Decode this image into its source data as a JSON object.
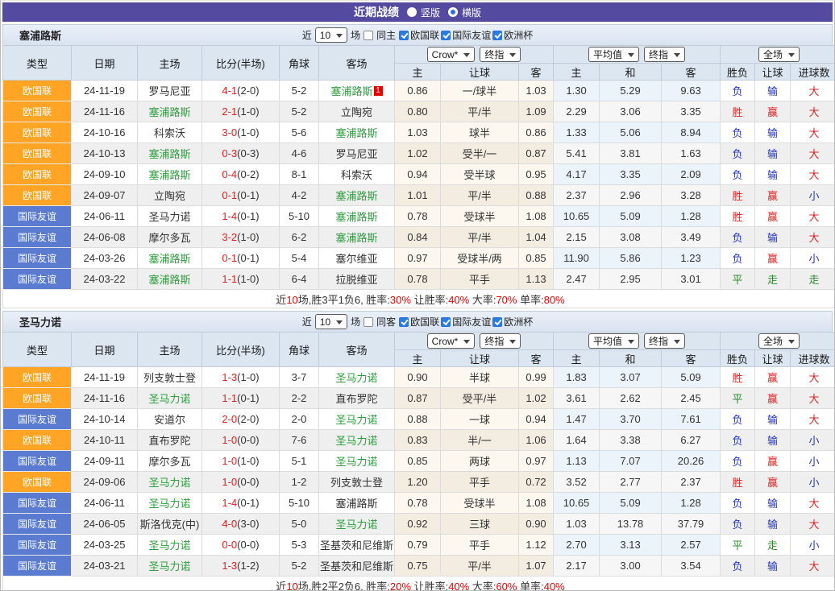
{
  "title_bar": {
    "title": "近期战绩",
    "radios": [
      {
        "label": "竖版",
        "checked": false
      },
      {
        "label": "横版",
        "checked": true
      }
    ]
  },
  "colors": {
    "titlebar_purple": "#544a9f",
    "focus_team_green": "#2e9e3e",
    "win_red": "#e02222",
    "lose_blue": "#2233cc",
    "draw_green": "#2e8b2e",
    "league_colors": {
      "欧国联": "#ffa424",
      "国际友谊": "#5a7bd0"
    }
  },
  "columns": [
    "类型",
    "日期",
    "主场",
    "比分(半场)",
    "角球",
    "客场",
    "主",
    "让球",
    "客",
    "主",
    "和",
    "客",
    "胜负",
    "让球",
    "进球数"
  ],
  "dropdowns": {
    "odds_source": "Crow*",
    "odds_final": "终指",
    "avg_source": "平均值",
    "avg_final": "终指",
    "scope": "全场"
  },
  "sections": [
    {
      "team": "塞浦路斯",
      "filter": {
        "near_label": "近",
        "count": "10",
        "games_label": "场",
        "same_label": "同主",
        "same_checked": false,
        "comps": [
          {
            "label": "欧国联",
            "checked": true
          },
          {
            "label": "国际友谊",
            "checked": true
          },
          {
            "label": "欧洲杯",
            "checked": true
          }
        ]
      },
      "rows": [
        {
          "type": "欧国联",
          "date": "24-11-19",
          "home": "罗马尼亚",
          "score": "4-1",
          "half": "(2-0)",
          "corners": "5-2",
          "away": "塞浦路斯",
          "away_badge": "1",
          "focus": "away",
          "odds": [
            "0.86",
            "一/球半",
            "1.03"
          ],
          "avg": [
            "1.30",
            "5.29",
            "9.63"
          ],
          "results": [
            [
              "负",
              "blue"
            ],
            [
              "输",
              "blue"
            ],
            [
              "大",
              "red"
            ]
          ]
        },
        {
          "type": "欧国联",
          "date": "24-11-16",
          "home": "塞浦路斯",
          "score": "2-1",
          "half": "(1-0)",
          "corners": "5-2",
          "away": "立陶宛",
          "focus": "home",
          "odds": [
            "0.80",
            "平/半",
            "1.09"
          ],
          "avg": [
            "2.29",
            "3.06",
            "3.35"
          ],
          "results": [
            [
              "胜",
              "red"
            ],
            [
              "赢",
              "red"
            ],
            [
              "大",
              "red"
            ]
          ]
        },
        {
          "type": "欧国联",
          "date": "24-10-16",
          "home": "科索沃",
          "score": "3-0",
          "half": "(1-0)",
          "corners": "5-6",
          "away": "塞浦路斯",
          "focus": "away",
          "odds": [
            "1.03",
            "球半",
            "0.86"
          ],
          "avg": [
            "1.33",
            "5.06",
            "8.94"
          ],
          "results": [
            [
              "负",
              "blue"
            ],
            [
              "输",
              "blue"
            ],
            [
              "大",
              "red"
            ]
          ]
        },
        {
          "type": "欧国联",
          "date": "24-10-13",
          "home": "塞浦路斯",
          "score": "0-3",
          "half": "(0-3)",
          "corners": "4-6",
          "away": "罗马尼亚",
          "focus": "home",
          "odds": [
            "1.02",
            "受半/一",
            "0.87"
          ],
          "avg": [
            "5.41",
            "3.81",
            "1.63"
          ],
          "results": [
            [
              "负",
              "blue"
            ],
            [
              "输",
              "blue"
            ],
            [
              "大",
              "red"
            ]
          ]
        },
        {
          "type": "欧国联",
          "date": "24-09-10",
          "home": "塞浦路斯",
          "score": "0-4",
          "half": "(0-2)",
          "corners": "8-1",
          "away": "科索沃",
          "focus": "home",
          "odds": [
            "0.94",
            "受半球",
            "0.95"
          ],
          "avg": [
            "4.17",
            "3.35",
            "2.09"
          ],
          "results": [
            [
              "负",
              "blue"
            ],
            [
              "输",
              "blue"
            ],
            [
              "大",
              "red"
            ]
          ]
        },
        {
          "type": "欧国联",
          "date": "24-09-07",
          "home": "立陶宛",
          "score": "0-1",
          "half": "(0-1)",
          "corners": "4-2",
          "away": "塞浦路斯",
          "focus": "away",
          "odds": [
            "1.01",
            "平/半",
            "0.88"
          ],
          "avg": [
            "2.37",
            "2.96",
            "3.28"
          ],
          "results": [
            [
              "胜",
              "red"
            ],
            [
              "赢",
              "red"
            ],
            [
              "小",
              "blue"
            ]
          ]
        },
        {
          "type": "国际友谊",
          "date": "24-06-11",
          "home": "圣马力诺",
          "score": "1-4",
          "half": "(0-1)",
          "corners": "5-10",
          "away": "塞浦路斯",
          "focus": "away",
          "odds": [
            "0.78",
            "受球半",
            "1.08"
          ],
          "avg": [
            "10.65",
            "5.09",
            "1.28"
          ],
          "results": [
            [
              "胜",
              "red"
            ],
            [
              "赢",
              "red"
            ],
            [
              "大",
              "red"
            ]
          ]
        },
        {
          "type": "国际友谊",
          "date": "24-06-08",
          "home": "摩尔多瓦",
          "score": "3-2",
          "half": "(1-0)",
          "corners": "6-2",
          "away": "塞浦路斯",
          "focus": "away",
          "odds": [
            "0.84",
            "平/半",
            "1.04"
          ],
          "avg": [
            "2.15",
            "3.08",
            "3.49"
          ],
          "results": [
            [
              "负",
              "blue"
            ],
            [
              "输",
              "blue"
            ],
            [
              "大",
              "red"
            ]
          ]
        },
        {
          "type": "国际友谊",
          "date": "24-03-26",
          "home": "塞浦路斯",
          "score": "0-1",
          "half": "(0-1)",
          "corners": "5-4",
          "away": "塞尔维亚",
          "focus": "home",
          "odds": [
            "0.97",
            "受球半/两",
            "0.85"
          ],
          "avg": [
            "11.90",
            "5.86",
            "1.23"
          ],
          "results": [
            [
              "负",
              "blue"
            ],
            [
              "赢",
              "red"
            ],
            [
              "小",
              "blue"
            ]
          ]
        },
        {
          "type": "国际友谊",
          "date": "24-03-22",
          "home": "塞浦路斯",
          "score": "1-1",
          "half": "(1-0)",
          "corners": "6-4",
          "away": "拉脱维亚",
          "focus": "home",
          "odds": [
            "0.78",
            "平手",
            "1.13"
          ],
          "avg": [
            "2.47",
            "2.95",
            "3.01"
          ],
          "results": [
            [
              "平",
              "green"
            ],
            [
              "走",
              "green"
            ],
            [
              "走",
              "green"
            ]
          ]
        }
      ],
      "summary": [
        [
          "近",
          0
        ],
        [
          "10",
          1
        ],
        [
          "场,胜3平1负6, 胜率:",
          0
        ],
        [
          "30%",
          1
        ],
        [
          " 让胜率:",
          0
        ],
        [
          "40%",
          1
        ],
        [
          " 大率:",
          0
        ],
        [
          "70%",
          1
        ],
        [
          " 单率:",
          0
        ],
        [
          "80%",
          1
        ]
      ]
    },
    {
      "team": "圣马力诺",
      "filter": {
        "near_label": "近",
        "count": "10",
        "games_label": "场",
        "same_label": "同客",
        "same_checked": false,
        "comps": [
          {
            "label": "欧国联",
            "checked": true
          },
          {
            "label": "国际友谊",
            "checked": true
          },
          {
            "label": "欧洲杯",
            "checked": true
          }
        ]
      },
      "rows": [
        {
          "type": "欧国联",
          "date": "24-11-19",
          "home": "列支敦士登",
          "score": "1-3",
          "half": "(1-0)",
          "corners": "3-7",
          "away": "圣马力诺",
          "focus": "away",
          "odds": [
            "0.90",
            "半球",
            "0.99"
          ],
          "avg": [
            "1.83",
            "3.07",
            "5.09"
          ],
          "results": [
            [
              "胜",
              "red"
            ],
            [
              "赢",
              "red"
            ],
            [
              "大",
              "red"
            ]
          ]
        },
        {
          "type": "欧国联",
          "date": "24-11-16",
          "home": "圣马力诺",
          "score": "1-1",
          "half": "(0-1)",
          "corners": "2-2",
          "away": "直布罗陀",
          "focus": "home",
          "odds": [
            "0.87",
            "受平/半",
            "1.02"
          ],
          "avg": [
            "3.61",
            "2.62",
            "2.45"
          ],
          "results": [
            [
              "平",
              "green"
            ],
            [
              "赢",
              "red"
            ],
            [
              "大",
              "red"
            ]
          ]
        },
        {
          "type": "国际友谊",
          "date": "24-10-14",
          "home": "安道尔",
          "score": "2-0",
          "half": "(2-0)",
          "corners": "2-0",
          "away": "圣马力诺",
          "focus": "away",
          "odds": [
            "0.88",
            "一球",
            "0.94"
          ],
          "avg": [
            "1.47",
            "3.70",
            "7.61"
          ],
          "results": [
            [
              "负",
              "blue"
            ],
            [
              "输",
              "blue"
            ],
            [
              "大",
              "red"
            ]
          ]
        },
        {
          "type": "欧国联",
          "date": "24-10-11",
          "home": "直布罗陀",
          "score": "1-0",
          "half": "(0-0)",
          "corners": "7-6",
          "away": "圣马力诺",
          "focus": "away",
          "odds": [
            "0.83",
            "半/一",
            "1.06"
          ],
          "avg": [
            "1.64",
            "3.38",
            "6.27"
          ],
          "results": [
            [
              "负",
              "blue"
            ],
            [
              "输",
              "blue"
            ],
            [
              "小",
              "blue"
            ]
          ]
        },
        {
          "type": "国际友谊",
          "date": "24-09-11",
          "home": "摩尔多瓦",
          "score": "1-0",
          "half": "(1-0)",
          "corners": "5-1",
          "away": "圣马力诺",
          "focus": "away",
          "odds": [
            "0.85",
            "两球",
            "0.97"
          ],
          "avg": [
            "1.13",
            "7.07",
            "20.26"
          ],
          "results": [
            [
              "负",
              "blue"
            ],
            [
              "赢",
              "red"
            ],
            [
              "小",
              "blue"
            ]
          ]
        },
        {
          "type": "欧国联",
          "date": "24-09-06",
          "home": "圣马力诺",
          "score": "1-0",
          "half": "(0-0)",
          "corners": "1-2",
          "away": "列支敦士登",
          "focus": "home",
          "odds": [
            "1.20",
            "平手",
            "0.72"
          ],
          "avg": [
            "3.52",
            "2.77",
            "2.37"
          ],
          "results": [
            [
              "胜",
              "red"
            ],
            [
              "赢",
              "red"
            ],
            [
              "小",
              "blue"
            ]
          ]
        },
        {
          "type": "国际友谊",
          "date": "24-06-11",
          "home": "圣马力诺",
          "score": "1-4",
          "half": "(0-1)",
          "corners": "5-10",
          "away": "塞浦路斯",
          "focus": "home",
          "odds": [
            "0.78",
            "受球半",
            "1.08"
          ],
          "avg": [
            "10.65",
            "5.09",
            "1.28"
          ],
          "results": [
            [
              "负",
              "blue"
            ],
            [
              "输",
              "blue"
            ],
            [
              "大",
              "red"
            ]
          ]
        },
        {
          "type": "国际友谊",
          "date": "24-06-05",
          "home": "斯洛伐克(中)",
          "score": "4-0",
          "half": "(3-0)",
          "corners": "5-0",
          "away": "圣马力诺",
          "focus": "away",
          "odds": [
            "0.92",
            "三球",
            "0.90"
          ],
          "avg": [
            "1.03",
            "13.78",
            "37.79"
          ],
          "results": [
            [
              "负",
              "blue"
            ],
            [
              "输",
              "blue"
            ],
            [
              "大",
              "red"
            ]
          ]
        },
        {
          "type": "国际友谊",
          "date": "24-03-25",
          "home": "圣马力诺",
          "score": "0-0",
          "half": "(0-0)",
          "corners": "5-3",
          "away": "圣基茨和尼维斯",
          "focus": "home",
          "odds": [
            "0.79",
            "平手",
            "1.12"
          ],
          "avg": [
            "2.70",
            "3.13",
            "2.57"
          ],
          "results": [
            [
              "平",
              "green"
            ],
            [
              "走",
              "green"
            ],
            [
              "小",
              "blue"
            ]
          ]
        },
        {
          "type": "国际友谊",
          "date": "24-03-21",
          "home": "圣马力诺",
          "score": "1-3",
          "half": "(1-2)",
          "corners": "5-2",
          "away": "圣基茨和尼维斯",
          "focus": "home",
          "odds": [
            "0.75",
            "平/半",
            "1.07"
          ],
          "avg": [
            "2.17",
            "3.00",
            "3.54"
          ],
          "results": [
            [
              "负",
              "blue"
            ],
            [
              "输",
              "blue"
            ],
            [
              "大",
              "red"
            ]
          ]
        }
      ],
      "summary": [
        [
          "近",
          0
        ],
        [
          "10",
          1
        ],
        [
          "场,胜2平2负6, 胜率:",
          0
        ],
        [
          "20%",
          1
        ],
        [
          " 让胜率:",
          0
        ],
        [
          "40%",
          1
        ],
        [
          " 大率:",
          0
        ],
        [
          "60%",
          1
        ],
        [
          " 单率:",
          0
        ],
        [
          "40%",
          1
        ]
      ]
    }
  ]
}
